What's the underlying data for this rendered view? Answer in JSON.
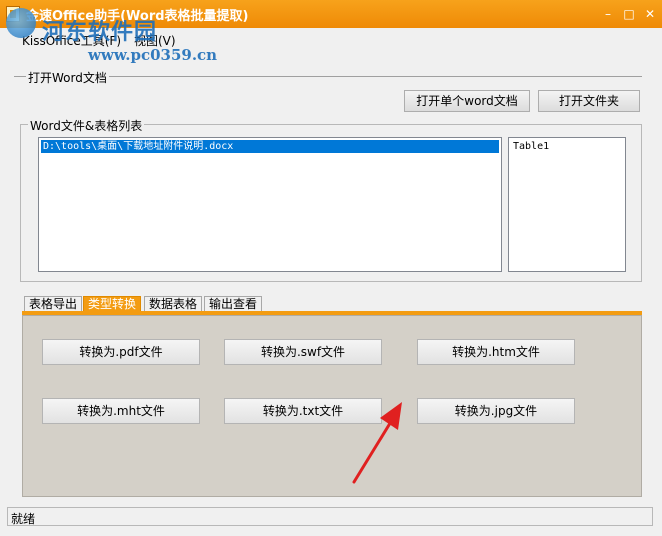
{
  "window": {
    "title": "金速Office助手(Word表格批量提取)",
    "controls": [
      "–",
      "□",
      "✕"
    ]
  },
  "watermark": {
    "title": "河东软件园",
    "url": "www.pc0359.cn"
  },
  "menu": {
    "items": [
      {
        "label": "KissOffice工具(F)"
      },
      {
        "label": "视图(V)"
      }
    ]
  },
  "open_group": {
    "label": "打开Word文档",
    "open_single_button": "打开单个word文档",
    "open_folder_button": "打开文件夹"
  },
  "list_group": {
    "label": "Word文件&表格列表",
    "files": [
      "D:\\tools\\桌面\\下载地址附件说明.docx"
    ],
    "tables": [
      "Table1"
    ]
  },
  "tabs": [
    {
      "label": "表格导出",
      "active": false
    },
    {
      "label": "类型转换",
      "active": true
    },
    {
      "label": "数据表格",
      "active": false
    },
    {
      "label": "输出查看",
      "active": false
    }
  ],
  "convert_buttons": [
    {
      "label": "转换为.pdf文件"
    },
    {
      "label": "转换为.swf文件"
    },
    {
      "label": "转换为.htm文件"
    },
    {
      "label": "转换为.mht文件"
    },
    {
      "label": "转换为.txt文件"
    },
    {
      "label": "转换为.jpg文件"
    }
  ],
  "status": {
    "text": "就绪"
  },
  "colors": {
    "titlebar": "#f39c12",
    "active_tab": "#f39c12",
    "selection": "#0078d7",
    "panel": "#d4d0c8",
    "annotation_arrow": "#e02020"
  },
  "icons": {
    "app": "app-icon",
    "annotation": "red-arrow"
  }
}
